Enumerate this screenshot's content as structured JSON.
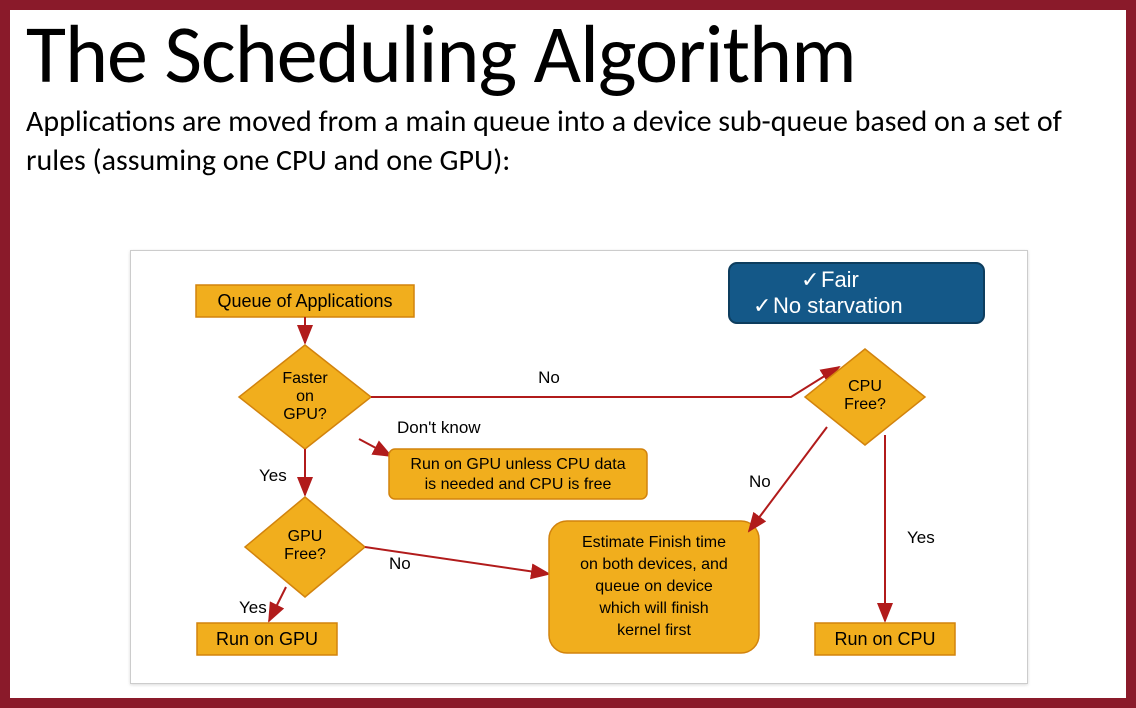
{
  "title": "The Scheduling Algorithm",
  "subtitle": "Applications are moved from a main queue into a device sub-queue based on a set of rules (assuming one CPU and one GPU):",
  "badge": {
    "line1": "Fair",
    "line2": "No starvation"
  },
  "nodes": {
    "queue": "Queue of Applications",
    "faster_gpu_l1": "Faster",
    "faster_gpu_l2": "on",
    "faster_gpu_l3": "GPU?",
    "gpu_free": "GPU",
    "gpu_free_l2": "Free?",
    "cpu_free": "CPU",
    "cpu_free_l2": "Free?",
    "run_gpu": "Run on GPU",
    "run_cpu": "Run on CPU",
    "dont_know_box_l1": "Run on GPU unless CPU data",
    "dont_know_box_l2": "is needed and CPU is free",
    "estimate_l1": "Estimate Finish time",
    "estimate_l2": "on both devices, and",
    "estimate_l3": "queue on device",
    "estimate_l4": "which will finish",
    "estimate_l5": "kernel first"
  },
  "edges": {
    "yes": "Yes",
    "no": "No",
    "dont_know": "Don't know",
    "no2": "No",
    "yes2": "Yes",
    "no3": "No",
    "yes3": "Yes"
  }
}
